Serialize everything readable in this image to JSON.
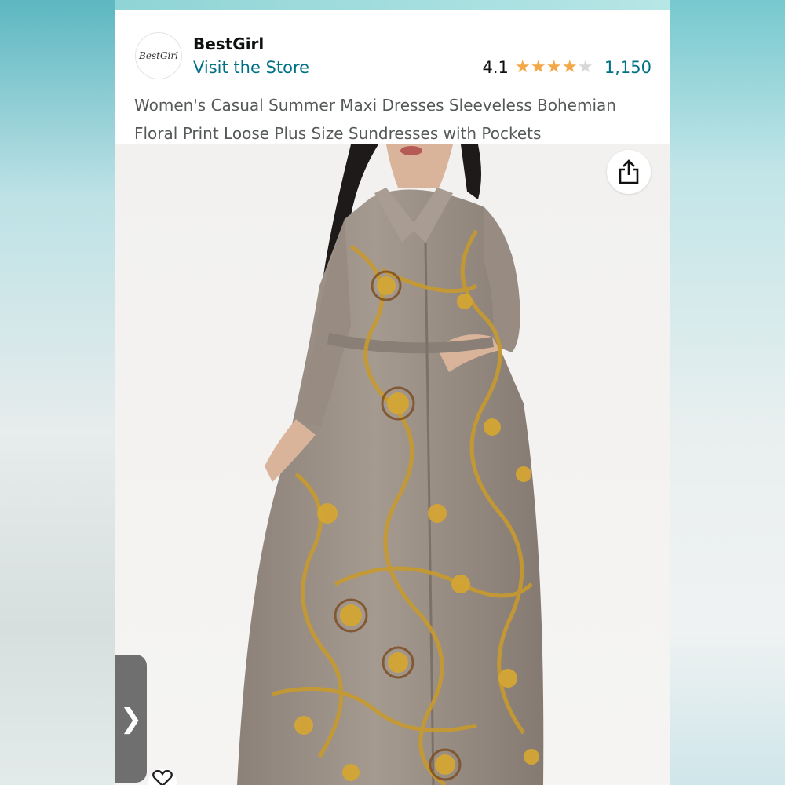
{
  "store": {
    "logo_text": "BestGirl",
    "name": "BestGirl",
    "visit_label": "Visit the Store"
  },
  "rating": {
    "value": "4.1",
    "stars_filled": 4,
    "stars_total": 5,
    "review_count": "1,150"
  },
  "product": {
    "title": "Women's Casual Summer Maxi Dresses Sleeveless Bohemian Floral Print Loose Plus Size Sundresses with Pockets"
  },
  "icons": {
    "share": "share-icon",
    "next": "chevron-right-icon",
    "favorite": "heart-icon"
  },
  "next_glyph": "❯",
  "colors": {
    "link": "#007185",
    "star": "#f3a847",
    "dress_base": "#9e938a",
    "print_gold": "#c89a2e"
  }
}
